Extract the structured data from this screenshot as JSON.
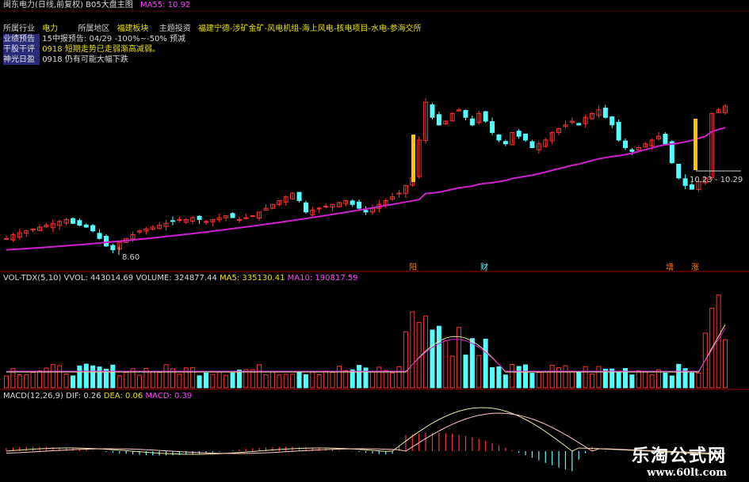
{
  "header": {
    "title": "闽东电力(日线,前复权) B05大盘主图",
    "ma_label": "MA55: 10.92"
  },
  "info_rows": [
    {
      "label": "所属行业",
      "value": "电力",
      "label2": "所属地区",
      "value2": "福建板块",
      "label3": "主题投资",
      "value3": "福建宁德-涉矿金矿-风电机组-海上风电-核电项目-水电-参海交所"
    },
    {
      "label": "业绩预告",
      "value": "15中报预告: 04/29 -100%~-50% 预减"
    },
    {
      "label": "干股干评",
      "value": "0918 短期走势已走弱渐高减弱。"
    },
    {
      "label": "神光日盈",
      "value": "0918 仍有可能大幅下跌"
    }
  ],
  "price_labels": {
    "low_label": "8.60",
    "range_label": "10.23 - 10.29"
  },
  "markers": [
    "阳",
    "财",
    "增",
    "涨"
  ],
  "volume_header": {
    "name": "VOL-TDX(5,10)",
    "vvol": "VVOL: 443014.69",
    "volume": "VOLUME: 324877.44",
    "ma5": "MA5: 335130.41",
    "ma10": "MA10: 190817.59"
  },
  "macd_header": {
    "name": "MACD(12,26,9)",
    "dif": "DIF: 0.26",
    "dea": "DEA: 0.06",
    "macd": "MACD: 0.39"
  },
  "watermark": {
    "site_name": "乐淘公式网",
    "site_url": "www.60lt.com"
  },
  "colors": {
    "up": "#ff3232",
    "down": "#54ffff",
    "ma_line": "#d020d0",
    "signal": "#ffbf00",
    "dif": "#e8e8a0",
    "dea": "#ffc8c8"
  },
  "chart_data": {
    "type": "candlestick",
    "price_seed": [
      9.0,
      9.1,
      9.15,
      9.2,
      9.25,
      9.3,
      9.35,
      9.4,
      9.45,
      9.5,
      9.4,
      9.35,
      9.3,
      9.2,
      9.0,
      8.8,
      8.7,
      8.9,
      9.0,
      9.1,
      9.2,
      9.25,
      9.3,
      9.35,
      9.4,
      9.45,
      9.5,
      9.5,
      9.55,
      9.5,
      9.45,
      9.5,
      9.55,
      9.6,
      9.55,
      9.5,
      9.55,
      9.6,
      9.7,
      9.8,
      9.9,
      10.0,
      10.1,
      10.2,
      10.0,
      9.7,
      9.75,
      9.8,
      9.85,
      9.9,
      9.95,
      10.0,
      9.9,
      9.8,
      9.7,
      9.8,
      9.9,
      10.0,
      10.1,
      10.2,
      10.4,
      10.6,
      11.6,
      12.6,
      12.2,
      12.0,
      12.1,
      12.3,
      12.4,
      12.2,
      12.0,
      12.3,
      12.1,
      11.8,
      11.6,
      11.5,
      11.8,
      11.7,
      11.6,
      11.4,
      11.5,
      11.6,
      11.8,
      11.9,
      12.0,
      12.1,
      12.0,
      12.2,
      12.3,
      12.4,
      12.2,
      12.0,
      11.6,
      11.4,
      11.3,
      11.4,
      11.5,
      11.6,
      11.7,
      11.5,
      11.0,
      10.6,
      10.4,
      10.3,
      10.5,
      10.6,
      12.3,
      12.4,
      12.5
    ],
    "ma55_range": [
      8.7,
      11.9
    ]
  }
}
